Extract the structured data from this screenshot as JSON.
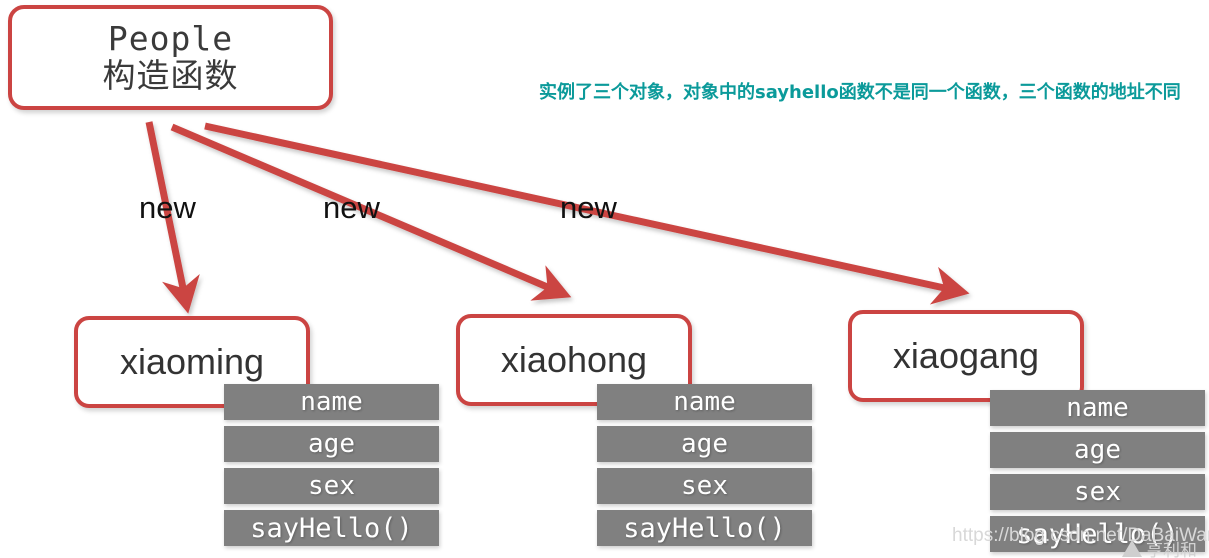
{
  "diagram": {
    "title_box": {
      "name": "people-constructor",
      "line1": "People",
      "line2": "构造函数"
    },
    "annotation": {
      "text": "实例了三个对象，对象中的sayhello函数不是同一个函数，三个函数的地址不同",
      "color": "#0b9a9a"
    },
    "edge_labels": [
      {
        "label": "new"
      },
      {
        "label": "new"
      },
      {
        "label": "new"
      }
    ],
    "instances": [
      {
        "name": "xiaoming",
        "properties": [
          "name",
          "age",
          "sex",
          "sayHello()"
        ]
      },
      {
        "name": "xiaohong",
        "properties": [
          "name",
          "age",
          "sex",
          "sayHello()"
        ]
      },
      {
        "name": "xiaogang",
        "properties": [
          "name",
          "age",
          "sex",
          "sayHello()"
        ]
      }
    ],
    "colors": {
      "box_border": "#cb4442",
      "arrow": "#cb4442",
      "property_row_bg": "#808080",
      "property_row_text": "#ffffff",
      "annotation": "#0b9a9a"
    }
  },
  "watermark": {
    "url": "https://blog.csdn.net/DaBaiWanJia",
    "logo_text": "亨利和"
  }
}
